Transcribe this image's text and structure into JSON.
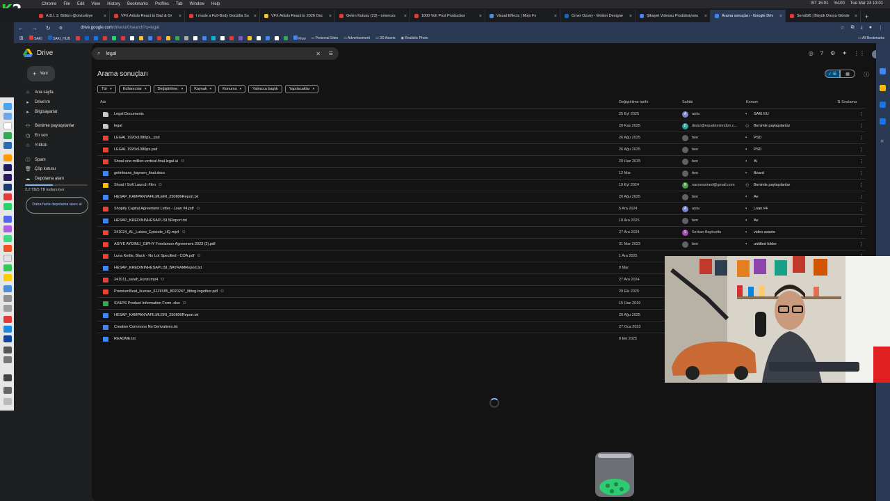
{
  "mac_menubar": {
    "items": [
      "Chrome",
      "File",
      "Edit",
      "View",
      "History",
      "Bookmarks",
      "Profiles",
      "Tab",
      "Window",
      "Help"
    ],
    "status": [
      "IST 15:01",
      "%100",
      "Tue Mar 24  13:01"
    ]
  },
  "logo_text": "K2",
  "browser_tabs": [
    {
      "label": "A.B.İ. 2. Bölüm @otvturkiye",
      "color": "#e53935",
      "active": false
    },
    {
      "label": "VFX Artists React to Bad & Gr",
      "color": "#e53935",
      "active": false
    },
    {
      "label": "I made a Full-Body Godzilla Su",
      "color": "#e53935",
      "active": false
    },
    {
      "label": "VFX Artists React to 2026 Osc",
      "color": "#fbc02d",
      "active": false
    },
    {
      "label": "Gelen Kutusu (23) - omerozs",
      "color": "#e53935",
      "active": false
    },
    {
      "label": "1000 Volt Post Production",
      "color": "#e53935",
      "active": false
    },
    {
      "label": "Visual Effects | Mojo Fx",
      "color": "#4a90d9",
      "active": false
    },
    {
      "label": "Omer Ozsoy - Motion Designe",
      "color": "#1565c0",
      "active": false
    },
    {
      "label": "Şikayet Videosu Prodüksiyonu",
      "color": "#4285f4",
      "active": false
    },
    {
      "label": "Arama sonuçları - Google Driv",
      "color": "#4285f4",
      "active": true
    },
    {
      "label": "SendGB | Büyük Dosya Gönde",
      "color": "#e53935",
      "active": false
    }
  ],
  "address": {
    "host": "drive.google.com",
    "path": "/drive/u/0/search?q=legal"
  },
  "bookmarks": [
    "SAKI",
    "SAKI_HUB",
    "Flow",
    "Personal Sites",
    "Advertisement",
    "3D Assets",
    "Realistic Photo",
    "All Bookmarks"
  ],
  "drive": {
    "app_name": "Drive",
    "new_label": "Yeni",
    "nav": [
      {
        "label": "Ana sayfa",
        "icon": "home-icon",
        "glyph": "⌂"
      },
      {
        "label": "Drive'ım",
        "icon": "my-drive-icon",
        "glyph": "▸"
      },
      {
        "label": "Bilgisayarlar",
        "icon": "computers-icon",
        "glyph": "▸"
      },
      {
        "label": "Benimle paylaşılanlar",
        "icon": "shared-icon",
        "glyph": "⚇"
      },
      {
        "label": "En son",
        "icon": "recent-icon",
        "glyph": "◷"
      },
      {
        "label": "Yıldızlı",
        "icon": "star-icon",
        "glyph": "☆"
      },
      {
        "label": "Spam",
        "icon": "spam-icon",
        "glyph": "ⓘ"
      },
      {
        "label": "Çöp kutusu",
        "icon": "trash-icon",
        "glyph": "🗑"
      },
      {
        "label": "Depolama alanı",
        "icon": "cloud-icon",
        "glyph": "☁"
      }
    ],
    "storage_text": "2,2 TB/5 TB kullanılıyor",
    "storage_fraction": 0.44,
    "more_storage_label": "Daha fazla depolama alanı al",
    "search_query": "legal",
    "results_title": "Arama sonuçları",
    "filters": [
      "Tür",
      "Kullanıcılar",
      "Değiştirilme:",
      "Kaynak",
      "Konumu",
      "Yalnızca başlık",
      "Yapılacaklar"
    ],
    "columns": {
      "name": "Adı",
      "modified": "Değiştirilme tarihi",
      "owner": "Sahibi",
      "location": "Konum",
      "sort": "Sıralama"
    },
    "files": [
      {
        "name": "Legal Documents",
        "type": "folder",
        "color": "#c4c7c5",
        "shared": false,
        "date": "25 Eyl 2025",
        "owner": "arda",
        "owner_color": "#7986cb",
        "owner_initial": "A",
        "location": "SAKI EU",
        "loc_icon": "▪"
      },
      {
        "name": "legal",
        "type": "folder",
        "color": "#c4c7c5",
        "shared": false,
        "date": "20 Kas 2025",
        "owner": "deniz@equationlondon.c...",
        "owner_color": "#26a69a",
        "owner_initial": "D",
        "location": "Benimle paylaşılanlar",
        "loc_icon": "⚇"
      },
      {
        "name": "LEGAL 1920x1080px_.psd",
        "type": "psd",
        "color": "#ea4335",
        "shared": false,
        "date": "26 Ağu 2025",
        "owner": "ben",
        "owner_color": "#5f6368",
        "owner_initial": "",
        "location": "PSD",
        "loc_icon": "▪"
      },
      {
        "name": "LEGAL 1920x1080px.psd",
        "type": "psd",
        "color": "#ea4335",
        "shared": false,
        "date": "26 Ağu 2025",
        "owner": "ben",
        "owner_color": "#5f6368",
        "owner_initial": "",
        "location": "PSD",
        "loc_icon": "▪"
      },
      {
        "name": "Shoal-one-million.vertical.final.legal.ai",
        "type": "ai",
        "color": "#ea4335",
        "shared": true,
        "date": "20 Haz 2025",
        "owner": "ben",
        "owner_color": "#5f6368",
        "owner_initial": "",
        "location": "Ai",
        "loc_icon": "▪"
      },
      {
        "name": "getirfinans_bayram_final.docx",
        "type": "doc",
        "color": "#4285f4",
        "shared": false,
        "date": "12 Mar",
        "owner": "ben",
        "owner_color": "#5f6368",
        "owner_initial": "",
        "location": "Board",
        "loc_icon": "▪"
      },
      {
        "name": "Shoal / Soft Launch Film",
        "type": "slides",
        "color": "#fbbc04",
        "shared": true,
        "date": "19 Eyl 2024",
        "owner": "nacneszined@gmail.com",
        "owner_color": "#43a047",
        "owner_initial": "N",
        "location": "Benimle paylaşılanlar",
        "loc_icon": "⚇"
      },
      {
        "name": "HESAP_KAMPANYAFILMLERI_250806Report.txt",
        "type": "txt",
        "color": "#4285f4",
        "shared": false,
        "date": "20 Ağu 2025",
        "owner": "ben",
        "owner_color": "#5f6368",
        "owner_initial": "",
        "location": "Ae",
        "loc_icon": "▪"
      },
      {
        "name": "Shopify Capital Agreement Letter - Loan #4.pdf",
        "type": "pdf",
        "color": "#ea4335",
        "shared": true,
        "date": "5 Ara 2024",
        "owner": "arda",
        "owner_color": "#7986cb",
        "owner_initial": "A",
        "location": "Loan #4",
        "loc_icon": "▪"
      },
      {
        "name": "HESAP_KREDININHESAPLISI 5Report.txt",
        "type": "txt",
        "color": "#4285f4",
        "shared": false,
        "date": "18 Ara 2025",
        "owner": "ben",
        "owner_color": "#5f6368",
        "owner_initial": "",
        "location": "Ae",
        "loc_icon": "▪"
      },
      {
        "name": "241024_AL_Lukies_Episode_HQ.mp4",
        "type": "video",
        "color": "#ea4335",
        "shared": true,
        "date": "27 Ara 2024",
        "owner": "Serkan Bayburtlu",
        "owner_color": "#ab47bc",
        "owner_initial": "S",
        "location": "video assets",
        "loc_icon": "▪"
      },
      {
        "name": "ASIYE AYDINLI_GIPHY Freelancer Agreement 2023 (2).pdf",
        "type": "pdf",
        "color": "#ea4335",
        "shared": false,
        "date": "31 Mar 2023",
        "owner": "ben",
        "owner_color": "#5f6368",
        "owner_initial": "",
        "location": "untitled folder",
        "loc_icon": "▪"
      },
      {
        "name": "Luna Kettle, Black - No Lot Specified - COA.pdf",
        "type": "pdf",
        "color": "#ea4335",
        "shared": true,
        "date": "1 Ara 2025",
        "owner": "",
        "owner_color": "",
        "owner_initial": "",
        "location": "",
        "loc_icon": ""
      },
      {
        "name": "HESAP_KREDININHESAPLISI_BAYRAMReport.txt",
        "type": "txt",
        "color": "#4285f4",
        "shared": false,
        "date": "9 Mar",
        "owner": "",
        "owner_color": "",
        "owner_initial": "",
        "location": "",
        "loc_icon": ""
      },
      {
        "name": "241011_sarah_kunst.mp4",
        "type": "video",
        "color": "#ea4335",
        "shared": true,
        "date": "27 Ara 2024",
        "owner": "",
        "owner_color": "",
        "owner_initial": "",
        "location": "",
        "loc_icon": ""
      },
      {
        "name": "PremiumBeat_license_6119185_8020247_fitting-together.pdf",
        "type": "pdf",
        "color": "#ea4335",
        "shared": true,
        "date": "29 Eki 2025",
        "owner": "",
        "owner_color": "",
        "owner_initial": "",
        "location": "",
        "loc_icon": ""
      },
      {
        "name": "SV&PS Product Information Form .xlsx",
        "type": "sheet",
        "color": "#34a853",
        "shared": true,
        "date": "15 Haz 2019",
        "owner": "",
        "owner_color": "",
        "owner_initial": "",
        "location": "",
        "loc_icon": ""
      },
      {
        "name": "HESAP_KAMPANYAFILMLERI_250806Report.txt",
        "type": "txt",
        "color": "#4285f4",
        "shared": false,
        "date": "20 Ağu 2025",
        "owner": "",
        "owner_color": "",
        "owner_initial": "",
        "location": "",
        "loc_icon": ""
      },
      {
        "name": "Creative Commons No Derivatives.txt",
        "type": "txt",
        "color": "#4285f4",
        "shared": false,
        "date": "27 Oca 2023",
        "owner": "",
        "owner_color": "",
        "owner_initial": "",
        "location": "",
        "loc_icon": ""
      },
      {
        "name": "README.txt",
        "type": "txt",
        "color": "#4285f4",
        "shared": false,
        "date": "8 Eki 2025",
        "owner": "",
        "owner_color": "",
        "owner_initial": "",
        "location": "",
        "loc_icon": ""
      }
    ]
  }
}
